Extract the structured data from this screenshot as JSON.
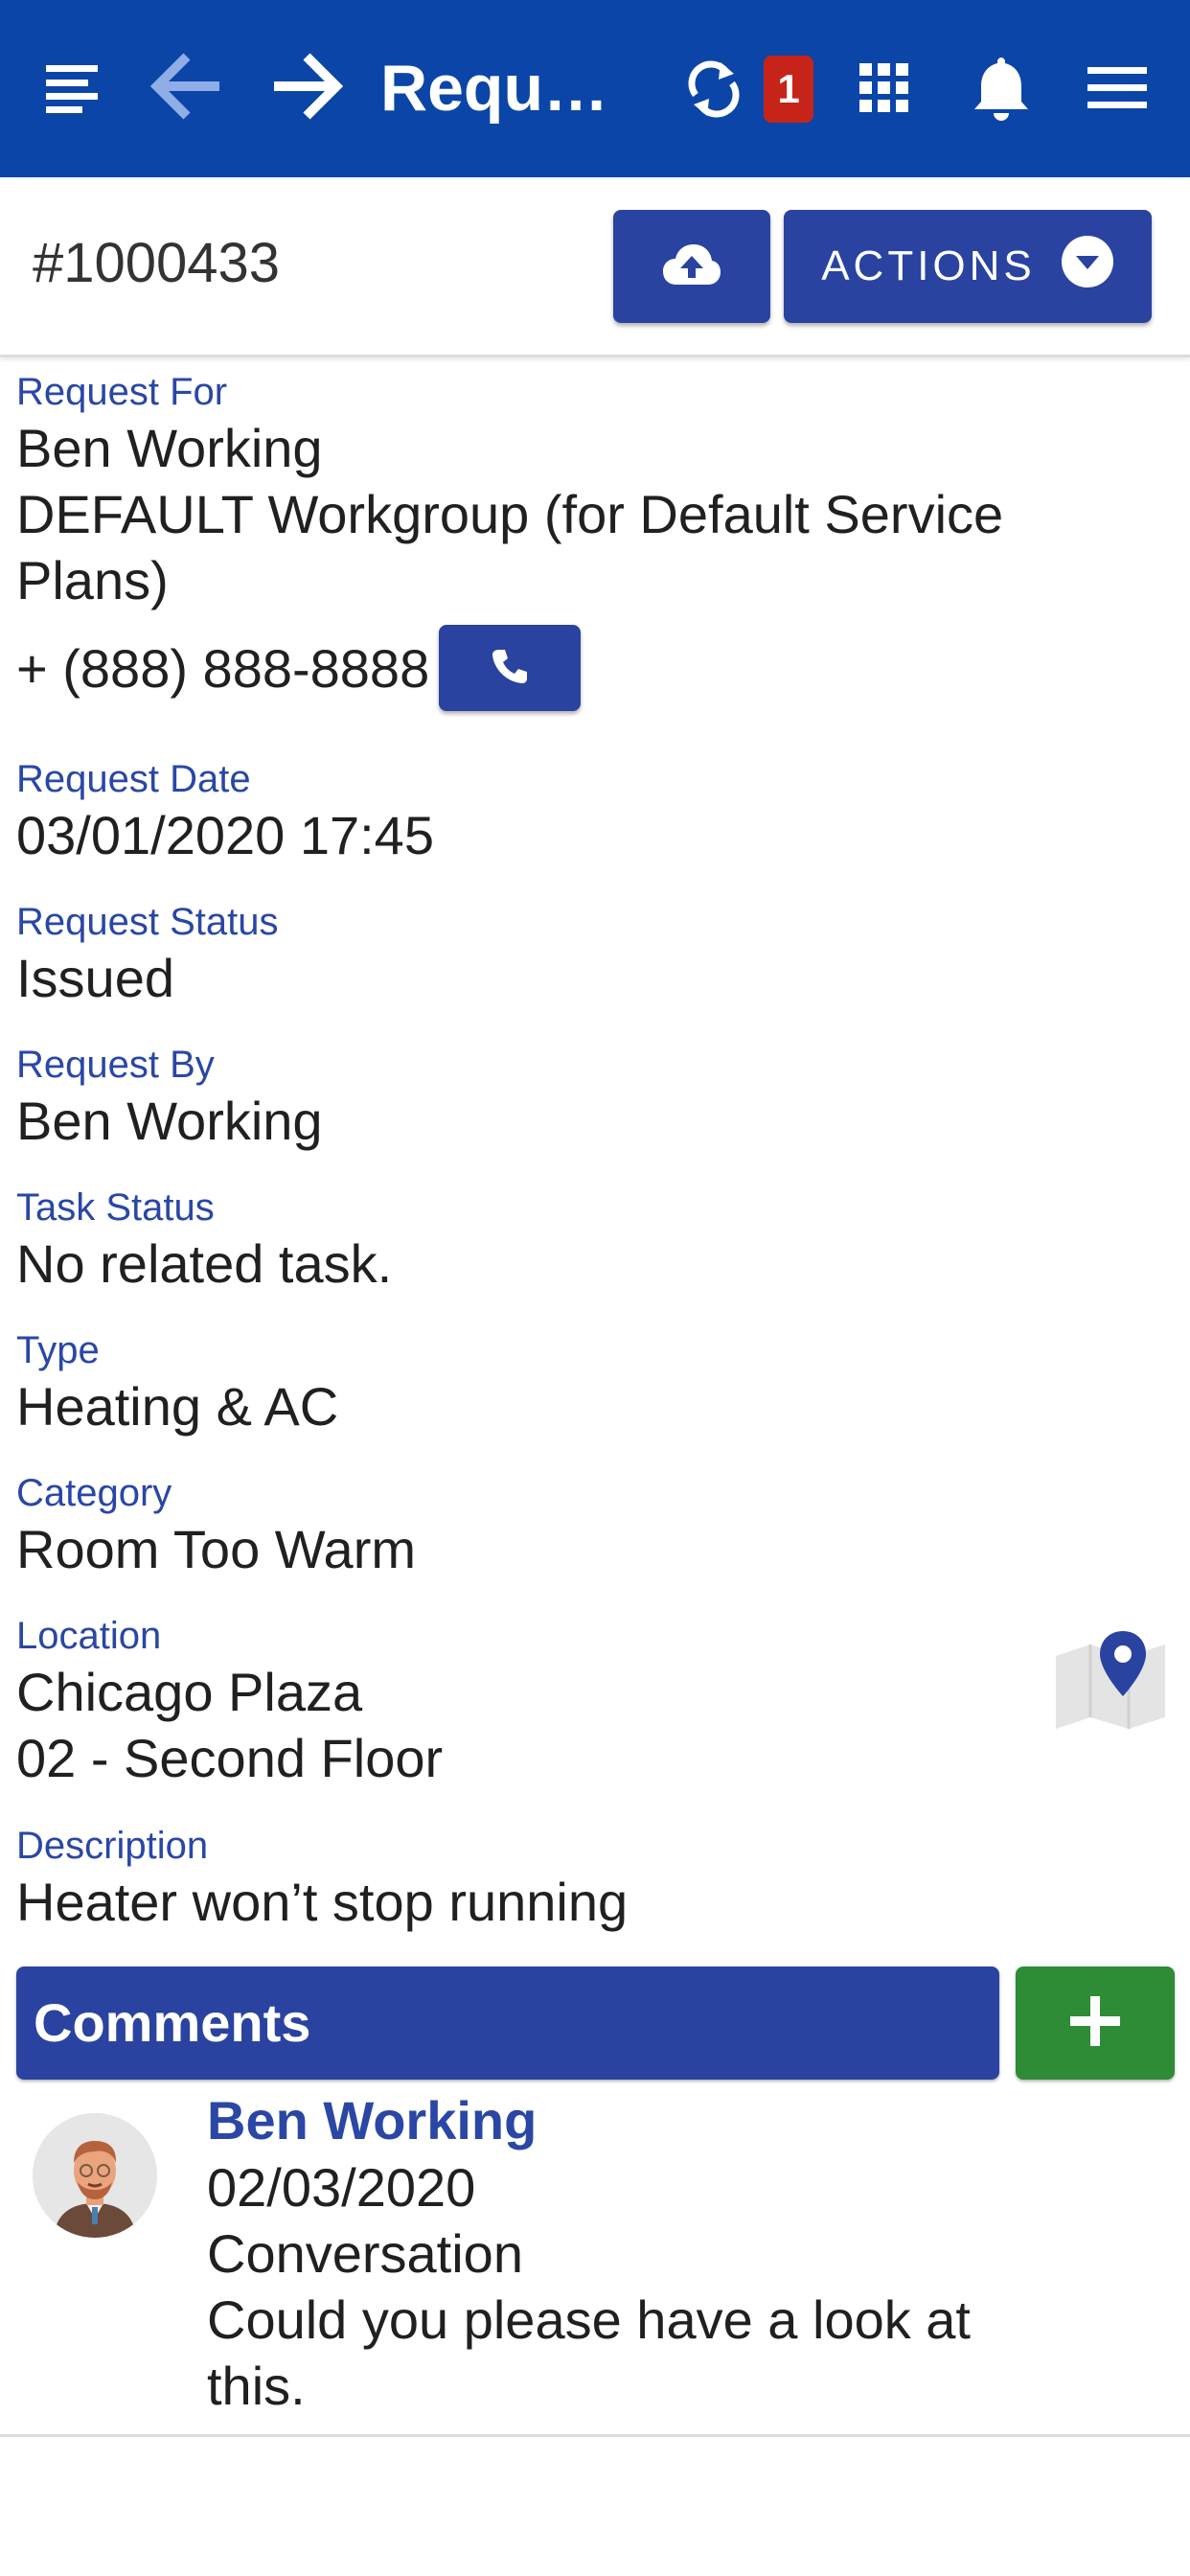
{
  "appbar": {
    "title": "Requ…",
    "sync_badge": "1",
    "icons": [
      "list-icon",
      "back-arrow-icon",
      "forward-arrow-icon",
      "sync-icon",
      "apps-grid-icon",
      "bell-icon",
      "menu-icon"
    ]
  },
  "header": {
    "request_id": "#1000433",
    "upload_icon": "cloud-upload-icon",
    "actions_label": "ACTIONS"
  },
  "fields": {
    "request_for": {
      "label": "Request For",
      "name": "Ben Working",
      "workgroup": "DEFAULT Workgroup (for Default Service Plans)",
      "phone": "+ (888) 888-8888"
    },
    "request_date": {
      "label": "Request Date",
      "value": "03/01/2020 17:45"
    },
    "request_status": {
      "label": "Request Status",
      "value": "Issued"
    },
    "request_by": {
      "label": "Request By",
      "value": "Ben Working"
    },
    "task_status": {
      "label": "Task Status",
      "value": "No related task."
    },
    "type": {
      "label": "Type",
      "value": "Heating & AC"
    },
    "category": {
      "label": "Category",
      "value": "Room Too Warm"
    },
    "location": {
      "label": "Location",
      "line1": "Chicago Plaza",
      "line2": "02 - Second Floor"
    },
    "description": {
      "label": "Description",
      "value": "Heater won’t stop running"
    }
  },
  "comments": {
    "title": "Comments",
    "items": [
      {
        "author": "Ben Working",
        "date": "02/03/2020",
        "kind": "Conversation",
        "text": "Could you please have a look at this."
      }
    ]
  },
  "colors": {
    "appbar": "#0b45a8",
    "button": "#2a43a0",
    "label": "#2a47a6",
    "badge": "#c62418",
    "add": "#2e8b36"
  }
}
